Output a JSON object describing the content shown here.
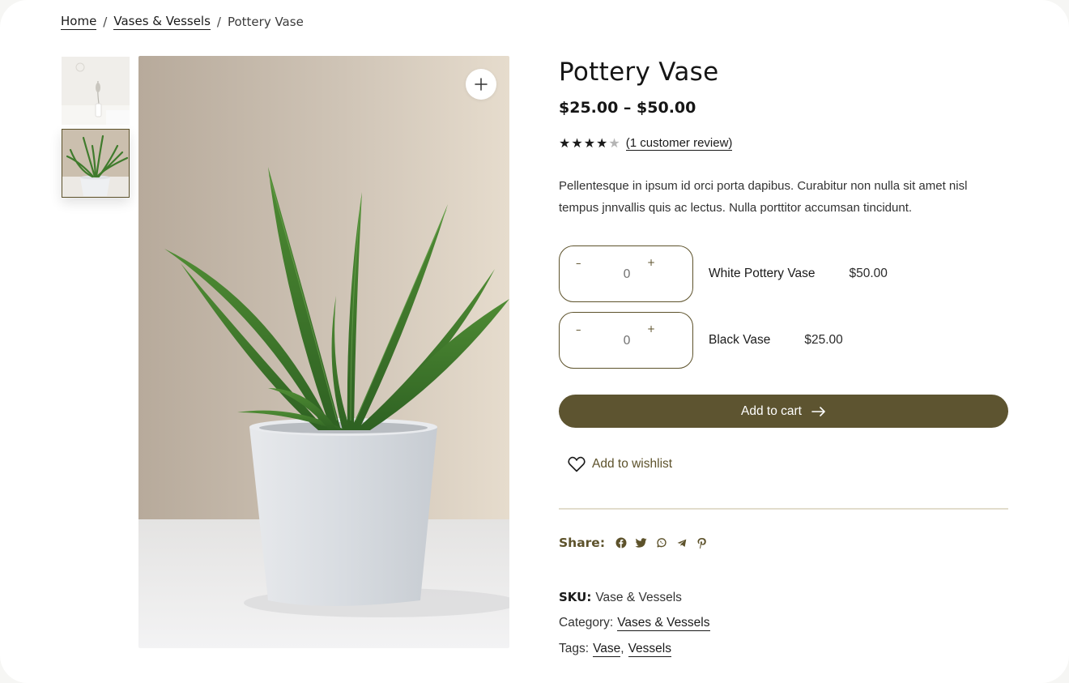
{
  "breadcrumb": {
    "home": "Home",
    "sep1": "/",
    "category": "Vases & Vessels",
    "sep2": "/",
    "current": "Pottery Vase"
  },
  "product": {
    "title": "Pottery Vase",
    "price_range": "$25.00 – $50.00",
    "rating": {
      "stars_filled": "★★★★",
      "stars_empty": "★",
      "value": 4,
      "max": 5,
      "review_link": "(1 customer review)"
    },
    "description": "Pellentesque in ipsum id orci porta dapibus. Curabitur non nulla sit amet nisl tempus jnnvallis quis ac lectus. Nulla porttitor accumsan tincidunt."
  },
  "variants": [
    {
      "name": "White Pottery Vase",
      "price": "$50.00",
      "qty": "0",
      "minus": "–",
      "plus": "+"
    },
    {
      "name": "Black Vase",
      "price": "$25.00",
      "qty": "0",
      "minus": "–",
      "plus": "+"
    }
  ],
  "actions": {
    "add_to_cart": "Add to cart",
    "add_to_wishlist": "Add to wishlist"
  },
  "share": {
    "label": "Share:",
    "icons": [
      "facebook-icon",
      "twitter-icon",
      "whatsapp-icon",
      "telegram-icon",
      "pinterest-icon"
    ]
  },
  "meta": {
    "sku_label": "SKU:",
    "sku_value": "Vase & Vessels",
    "category_label": "Category:",
    "category_value": "Vases & Vessels",
    "tags_label": "Tags:",
    "tags": [
      "Vase",
      "Vessels"
    ],
    "tag_separator": ","
  },
  "colors": {
    "accent": "#5d5430",
    "accent_text": "#5d522b",
    "divider": "#e2ddcc",
    "background": "#ffffff"
  }
}
